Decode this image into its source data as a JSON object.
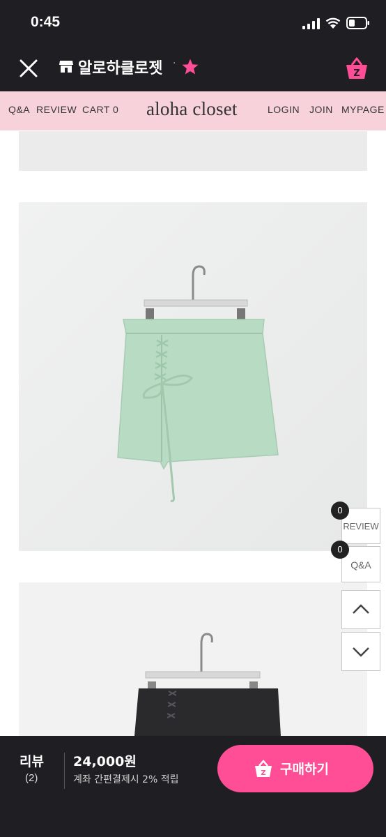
{
  "status": {
    "time": "0:45"
  },
  "nav": {
    "shop_name": "알로하클로젯",
    "separator": "·"
  },
  "header": {
    "qa": "Q&A",
    "review": "REVIEW",
    "cart": "CART 0",
    "logo": "aloha closet",
    "login": "LOGIN",
    "join": "JOIN",
    "mypage": "MYPAGE"
  },
  "side": {
    "review_label": "REVIEW",
    "review_count": "0",
    "qa_label": "Q&A",
    "qa_count": "0"
  },
  "bottom": {
    "review_label": "리뷰",
    "review_count": "(2)",
    "price": "24,000원",
    "benefit": "계좌 간편결제시 2% 적립",
    "buy_label": "구매하기"
  },
  "colors": {
    "accent": "#ff4d96",
    "header_bg": "#f8d2db",
    "dark_bg": "#1f1f23"
  }
}
